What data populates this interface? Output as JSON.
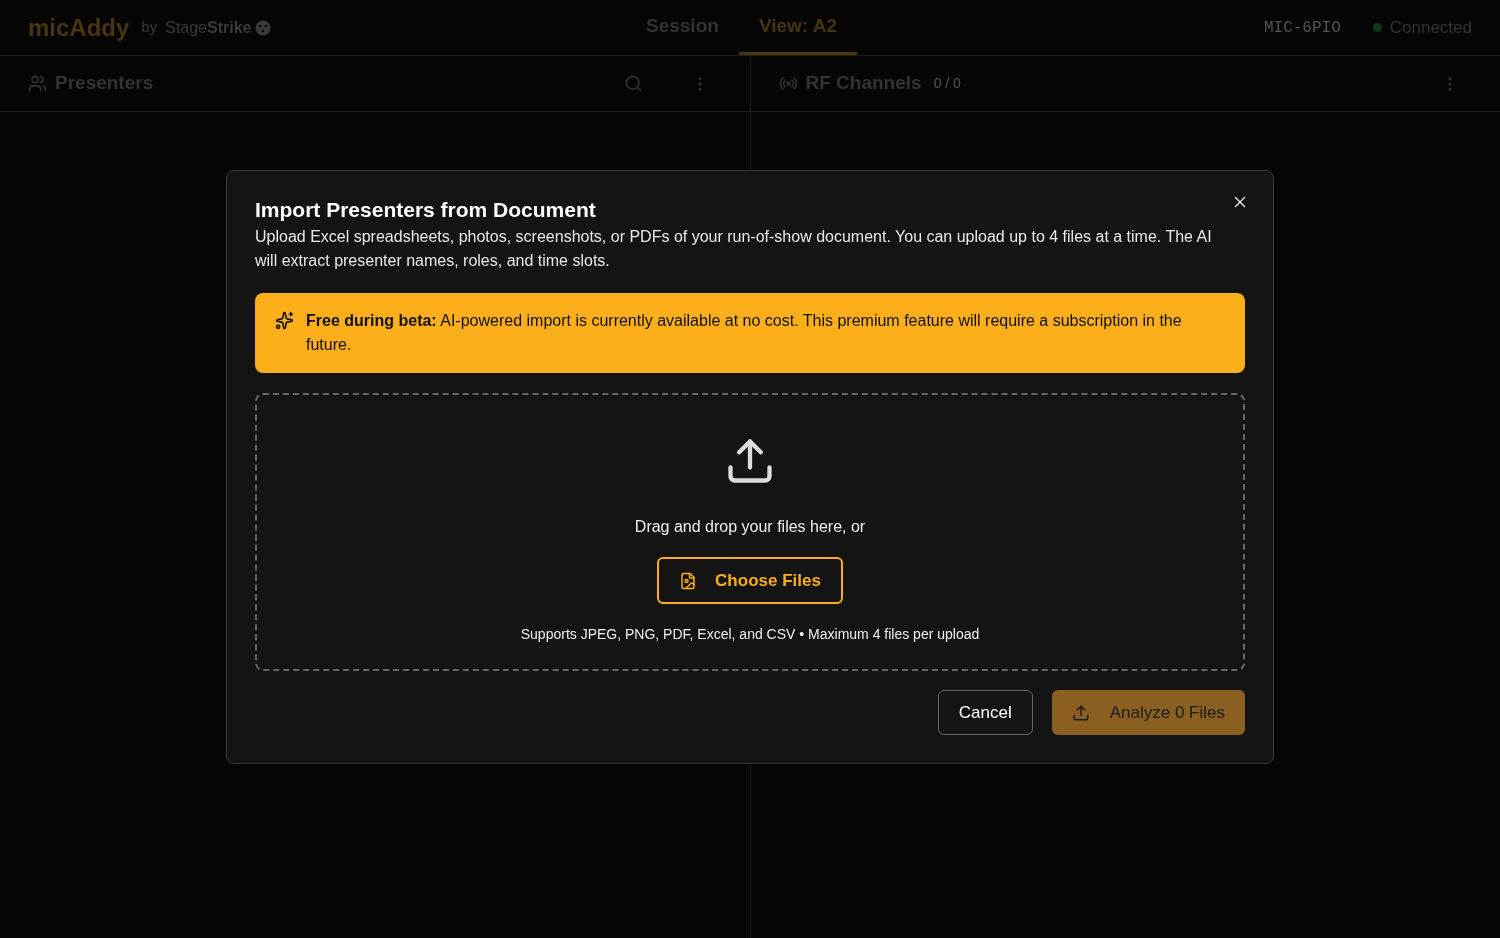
{
  "header": {
    "logo": "micAddy",
    "by": "by",
    "brand": "Stage**Strike**",
    "tabs": [
      {
        "label": "Session",
        "selected": false
      },
      {
        "label": "View: A2",
        "selected": true
      }
    ],
    "device": "MIC-6PIO",
    "status": {
      "label": "Connected",
      "connected": true
    }
  },
  "panels": [
    {
      "title": "Presenters"
    },
    {
      "title": "RF Channels",
      "count": "0 / 0"
    }
  ],
  "dialog": {
    "title": "Import Presenters from Document",
    "description": "Upload Excel spreadsheets, photos, screenshots, or PDFs of your run-of-show document. You can upload up to 4 files at a time. The AI will extract presenter names, roles, and time slots.",
    "notice": "**Free during beta:** AI-powered import is currently available at no cost. This premium feature will require a subscription in the future.",
    "dropzone": {
      "prompt": "Drag and drop your files here, or",
      "button": "Choose Files",
      "hint": "Supports JPEG, PNG, PDF, Excel, and CSV • Maximum 4 files per upload"
    },
    "cancel": "Cancel",
    "submit": {
      "label": "Analyze 0 Files",
      "disabled": true
    }
  }
}
